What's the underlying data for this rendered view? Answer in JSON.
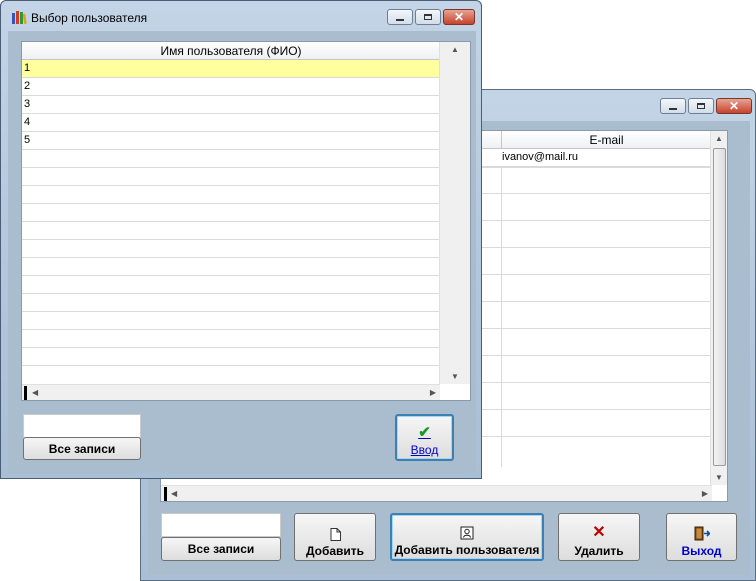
{
  "back_window": {
    "column_email": "E-mail",
    "rows": [
      "ivanov@mail.ru"
    ],
    "all_records_label": "Все записи",
    "buttons": {
      "add": "Добавить",
      "add_user": "Добавить пользователя",
      "delete": "Удалить",
      "exit": "Выход"
    }
  },
  "front_window": {
    "title": "Выбор пользователя",
    "column_name": "Имя пользователя (ФИО)",
    "rows": [
      "1",
      "2",
      "3",
      "4",
      "5"
    ],
    "all_records_label": "Все записи",
    "enter_label": "Ввод"
  },
  "colors": {
    "selected_row": "#ffff9e",
    "exit_text": "#0000cc",
    "enter_text": "#0000cc",
    "delete_icon": "#c00000",
    "ok_icon": "#1a9a2a"
  },
  "icons": {
    "app": "books-icon",
    "add": "document-icon",
    "add_user": "user-card-icon",
    "delete": "red-x-icon",
    "exit": "exit-door-icon",
    "enter": "checkmark-icon"
  }
}
